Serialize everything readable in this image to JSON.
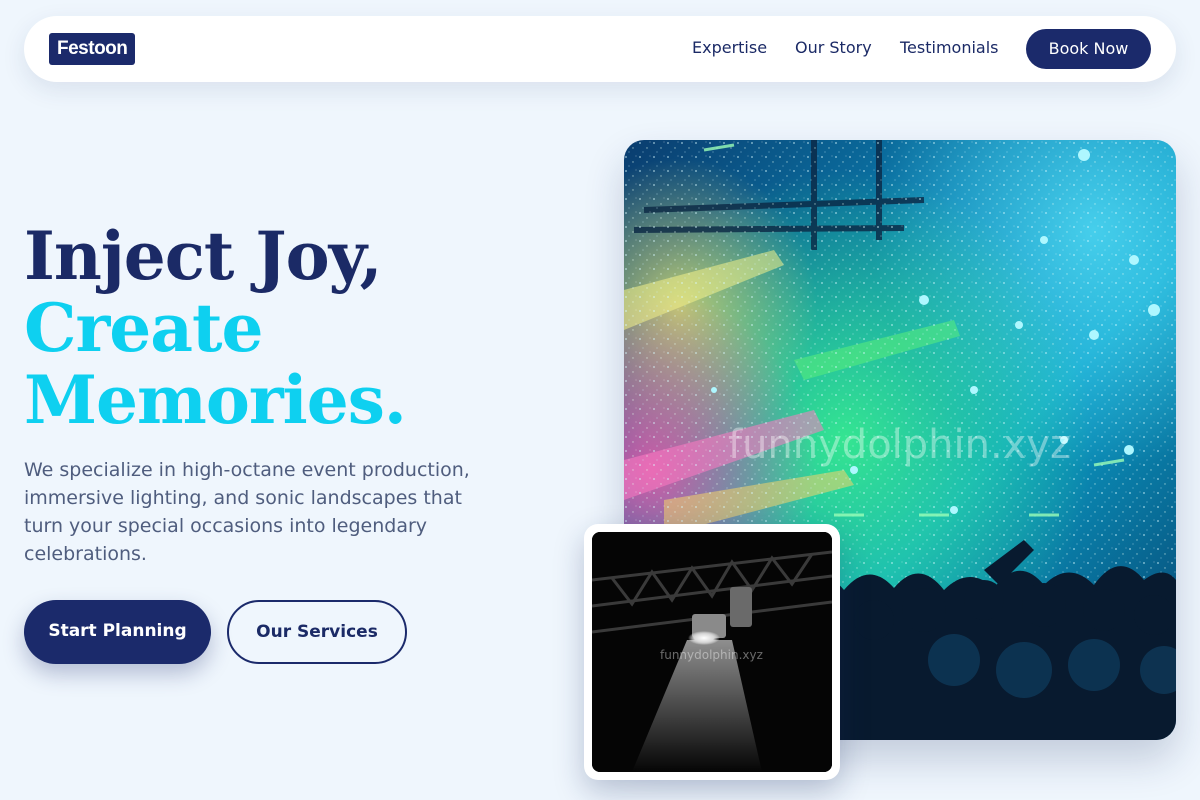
{
  "brand": {
    "logo": "Festoon"
  },
  "nav": {
    "links": [
      "Expertise",
      "Our Story",
      "Testimonials"
    ],
    "cta": "Book Now"
  },
  "hero": {
    "line1": "Inject Joy,",
    "line2": "Create",
    "line3": "Memories.",
    "subtitle": "We specialize in high-octane event production, immersive lighting, and sonic landscapes that turn your special occasions into legendary celebrations.",
    "primary_button": "Start Planning",
    "secondary_button": "Our Services"
  },
  "images": {
    "main_watermark": "funnydolphin.xyz",
    "card_watermark": "funnydolphin.xyz"
  },
  "colors": {
    "navy": "#1b2a6b",
    "cyan": "#0ed0f0",
    "background": "#eff6fd"
  }
}
